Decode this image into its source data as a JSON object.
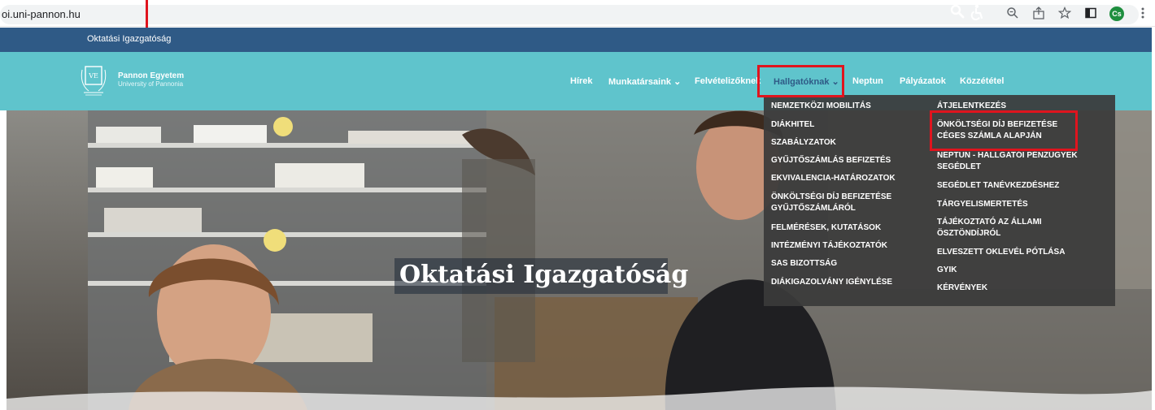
{
  "browser": {
    "url": "oi.uni-pannon.hu",
    "profile_initials": "Cs",
    "icons": [
      "zoom-icon",
      "share-icon",
      "star-icon",
      "sidepanel-icon",
      "profile-avatar",
      "menu-icon"
    ]
  },
  "topbar": {
    "title": "Oktatási Igazgatóság",
    "icons": [
      "search-icon",
      "accessibility-icon"
    ]
  },
  "logo": {
    "name": "Pannon Egyetem",
    "sub": "University of Pannonia"
  },
  "nav": {
    "items": [
      {
        "label": "Hírek",
        "dropdown": false
      },
      {
        "label": "Munkatársaink",
        "dropdown": true
      },
      {
        "label": "Felvételizőknek",
        "dropdown": false
      },
      {
        "label": "Hallgatóknak",
        "dropdown": true,
        "active": true
      },
      {
        "label": "Neptun",
        "dropdown": false
      },
      {
        "label": "Pályázatok",
        "dropdown": false
      },
      {
        "label": "Közzététel",
        "dropdown": false
      }
    ]
  },
  "hero": {
    "title": "Oktatási Igazgatóság"
  },
  "dropdown": {
    "left_column": [
      "NEMZETKÖZI MOBILITÁS",
      "DIÁKHITEL",
      "SZABÁLYZATOK",
      "GYŰJTŐSZÁMLÁS BEFIZETÉS",
      "EKVIVALENCIA-HATÁROZATOK",
      "ÖNKÖLTSÉGI DÍJ BEFIZETÉSE GYŰJTŐSZÁMLÁRÓL",
      "FELMÉRÉSEK, KUTATÁSOK",
      "INTÉZMÉNYI TÁJÉKOZTATÓK",
      "SAS BIZOTTSÁG",
      "DIÁKIGAZOLVÁNY IGÉNYLÉSE"
    ],
    "right_column": [
      "ÁTJELENTKEZÉS",
      "ÖNKÖLTSÉGI DÍJ BEFIZETÉSE CÉGES SZÁMLA ALAPJÁN",
      "NEPTUN - HALLGATÓI PÉNZÜGYEK SEGÉDLET",
      "SEGÉDLET TANÉVKEZDÉSHEZ",
      "TÁRGYELISMERTETÉS",
      "TÁJÉKOZTATÓ AZ ÁLLAMI ÖSZTÖNDÍJRÓL",
      "ELVESZETT OKLEVÉL PÓTLÁSA",
      "GYIK",
      "KÉRVÉNYEK"
    ]
  },
  "colors": {
    "top_bar": "#2f5a86",
    "nav_bar": "#5fc4cc",
    "highlight": "#e0141e",
    "dropdown_bg": "#3a3a3a"
  }
}
